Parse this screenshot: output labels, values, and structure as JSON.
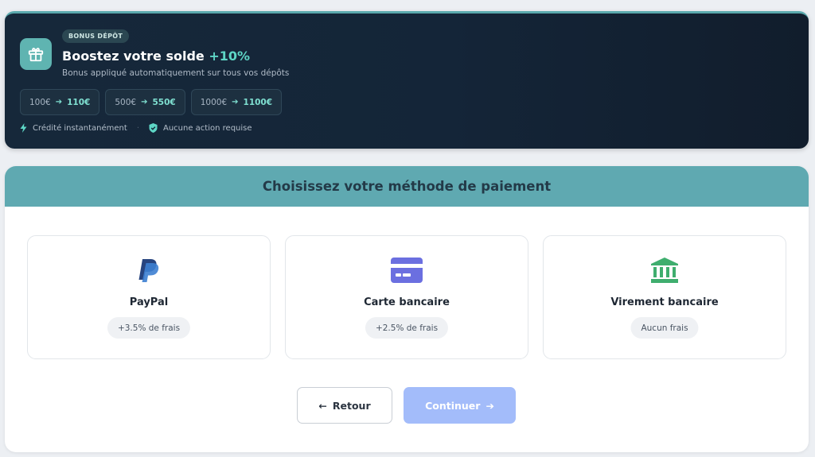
{
  "bonus": {
    "badge": "BONUS DÉPÔT",
    "title": "Boostez votre solde",
    "title_accent": "+10%",
    "subtitle": "Bonus appliqué automatiquement sur tous vos dépôts",
    "chips": [
      {
        "from": "100€",
        "to": "110€"
      },
      {
        "from": "500€",
        "to": "550€"
      },
      {
        "from": "1000€",
        "to": "1100€"
      }
    ],
    "perks": [
      {
        "icon": "lightning-icon",
        "label": "Crédité instantanément"
      },
      {
        "icon": "shield-check-icon",
        "label": "Aucune action requise"
      }
    ],
    "icon": "gift-icon"
  },
  "payment": {
    "title": "Choisissez votre méthode de paiement",
    "methods": [
      {
        "name": "PayPal",
        "fee": "+3.5% de frais",
        "icon": "paypal-icon",
        "color": "#2f5fa8"
      },
      {
        "name": "Carte bancaire",
        "fee": "+2.5% de frais",
        "icon": "credit-card-icon",
        "color": "#6b6fe0"
      },
      {
        "name": "Virement bancaire",
        "fee": "Aucun frais",
        "icon": "bank-icon",
        "color": "#3fae6e"
      }
    ],
    "back_label": "Retour",
    "continue_label": "Continuer"
  },
  "colors": {
    "accent": "#5fa9b1",
    "banner_bg": "#142538",
    "bonus_accent": "#5ed6c6",
    "continue_disabled": "#a3bcfa"
  }
}
